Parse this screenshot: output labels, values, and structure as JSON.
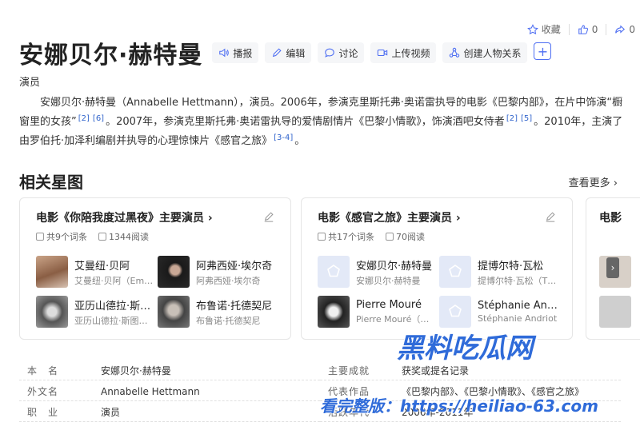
{
  "toolbar": {
    "favorite_label": "收藏",
    "like_count": "0",
    "share_count": "0"
  },
  "title": "安娜贝尔·赫特曼",
  "actions": [
    "播报",
    "编辑",
    "讨论",
    "上传视频",
    "创建人物关系"
  ],
  "subtitle": "演员",
  "summary": {
    "p1": "安娜贝尔·赫特曼（Annabelle Hettmann），演员。2006年，参演克里斯托弗·奥诺雷执导的电影《巴黎内部》，在片中饰演“橱窗里的女孩”",
    "ref1": "[2]",
    "ref2": "[6]",
    "p2": "。2007年，参演克里斯托弗·奥诺雷执导的爱情剧情片《巴黎小情歌》，饰演酒吧女侍者",
    "ref3": "[2]",
    "ref4": "[5]",
    "p3": "。2010年，主演了由罗伯托·加泽利编剧并执导的心理惊悚片《感官之旅》",
    "ref5": "[3-4]",
    "p4": "。"
  },
  "related": {
    "title": "相关星图",
    "more": "查看更多",
    "cards": [
      {
        "title": "电影《你陪我度过黑夜》主要演员",
        "entries": "共9个词条",
        "reads": "1344阅读",
        "people": [
          {
            "name": "艾曼纽·贝阿",
            "sub": "艾曼纽·贝阿（Emmanuelle Béart）"
          },
          {
            "name": "阿弗西娅·埃尔奇",
            "sub": "阿弗西娅·埃尔奇"
          },
          {
            "name": "亚历山德拉·斯图尔特",
            "sub": "亚历山德拉·斯图尔特"
          },
          {
            "name": "布鲁诺·托德契尼",
            "sub": "布鲁诺·托德契尼"
          }
        ]
      },
      {
        "title": "电影《感官之旅》主要演员",
        "entries": "共17个词条",
        "reads": "70阅读",
        "people": [
          {
            "name": "安娜贝尔·赫特曼",
            "sub": "安娜贝尔·赫特曼"
          },
          {
            "name": "提博尔特·瓦松",
            "sub": "提博尔特·瓦松（Thibault Vinçon）"
          },
          {
            "name": "Pierre Mouré",
            "sub": "Pierre Mouré（皮埃尔）"
          },
          {
            "name": "Stéphanie Andriot",
            "sub": "Stéphanie Andriot"
          }
        ]
      },
      {
        "title": "电影"
      }
    ]
  },
  "info": {
    "left": [
      {
        "label": "本　名",
        "value": "安娜贝尔·赫特曼"
      },
      {
        "label": "外文名",
        "value": "Annabelle Hettmann"
      },
      {
        "label": "职　业",
        "value": "演员"
      }
    ],
    "right": [
      {
        "label": "主要成就",
        "value": "获奖或提名记录"
      },
      {
        "label": "代表作品",
        "value": "《巴黎内部》、《巴黎小情歌》、《感官之旅》"
      },
      {
        "label": "活跃年代",
        "value": "2006年-2011年"
      }
    ]
  },
  "watermark": {
    "line1": "黑料吃瓜网",
    "line2": "看完整版：https://heiliao-63.com"
  },
  "colors": {
    "accent": "#4e6ef2",
    "link": "#3366cc",
    "watermark": "#2f6bd9"
  }
}
